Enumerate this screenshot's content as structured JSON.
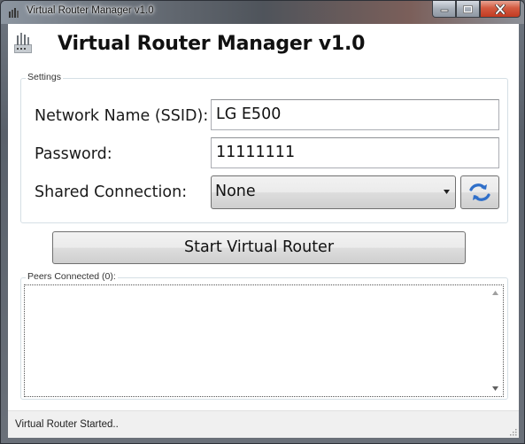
{
  "window": {
    "title": "Virtual Router Manager v1.0",
    "app_icon": "router-icon",
    "controls": [
      "minimize-icon",
      "maximize-icon",
      "close-icon"
    ]
  },
  "header": {
    "title": "Virtual Router Manager v1.0",
    "icon": "router-icon"
  },
  "settings": {
    "legend": "Settings",
    "ssid_label": "Network Name (SSID):",
    "ssid_value": "LG E500",
    "password_label": "Password:",
    "password_value": "11111111",
    "shared_label": "Shared Connection:",
    "shared_selected": "None",
    "refresh_icon": "refresh-icon"
  },
  "actions": {
    "start_label": "Start Virtual Router"
  },
  "peers": {
    "legend": "Peers Connected (0):",
    "items": []
  },
  "status": {
    "text": "Virtual Router Started.."
  },
  "colors": {
    "close_button": "#c9432a",
    "refresh_accent": "#2f6fc9",
    "group_border": "#d5dfe5"
  }
}
